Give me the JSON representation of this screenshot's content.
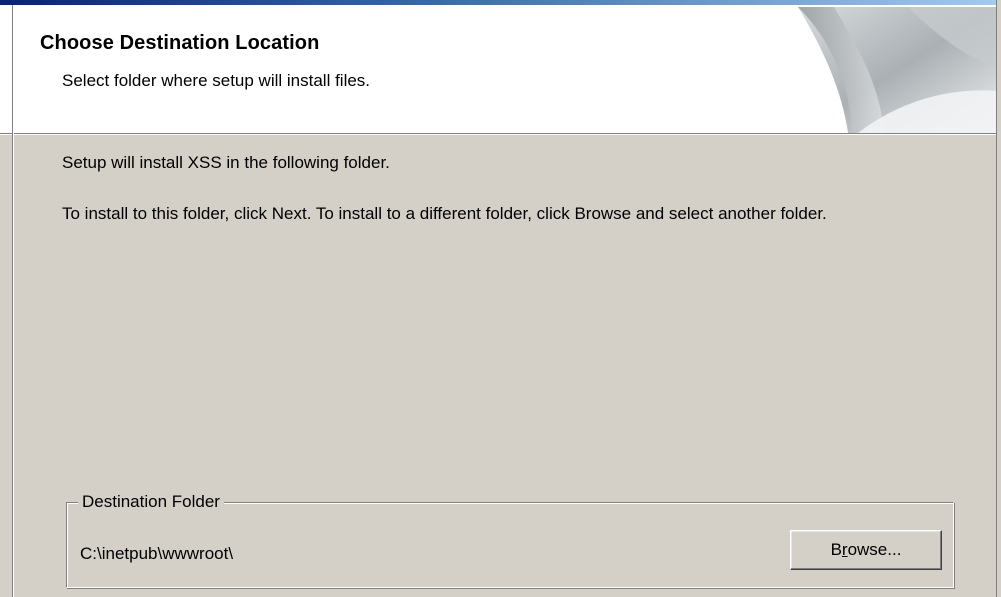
{
  "header": {
    "title": "Choose Destination Location",
    "subtitle": "Select folder where setup will install files."
  },
  "body": {
    "line1": "Setup will install XSS in the following folder.",
    "line2": "To install to this folder, click Next. To install to a different folder, click Browse and select another folder."
  },
  "destination": {
    "group_label": "Destination Folder",
    "path": "C:\\inetpub\\wwwroot\\",
    "browse": {
      "pre": "B",
      "accel": "r",
      "post": "owse..."
    }
  },
  "colors": {
    "dialog_face": "#d4d0c8",
    "header_bg": "#ffffff",
    "title_bar_accent": "#0a246a"
  }
}
